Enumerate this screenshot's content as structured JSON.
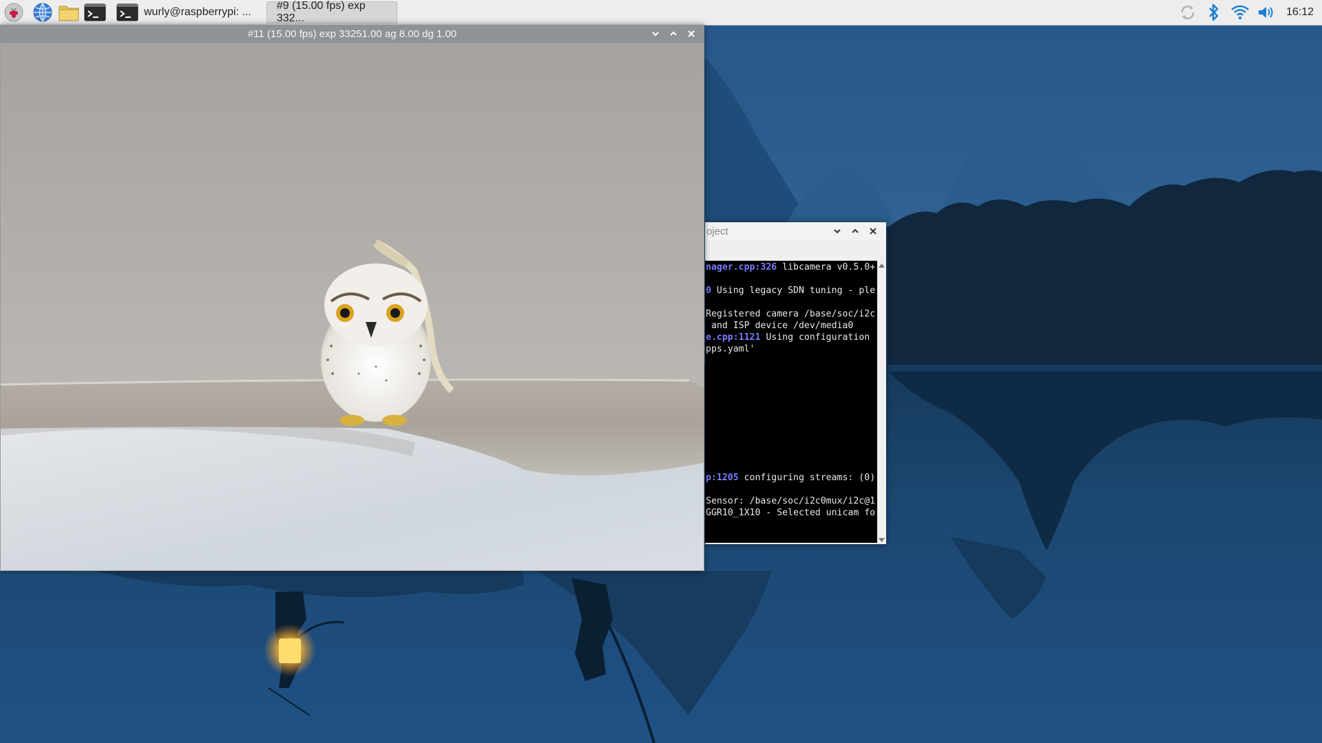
{
  "taskbar": {
    "launchers": [
      "raspberry-menu",
      "web-browser",
      "file-manager",
      "terminal"
    ],
    "tasks": [
      {
        "label": "wurly@raspberrypi: ...",
        "active": false
      },
      {
        "label": "#9 (15.00 fps) exp 332...",
        "active": true
      }
    ],
    "tray": [
      "sync-icon",
      "bluetooth-icon",
      "wifi-icon",
      "volume-icon"
    ],
    "clock": "16:12"
  },
  "camera_window": {
    "title": "#11 (15.00 fps) exp 33251.00 ag 8.00 dg 1.00"
  },
  "terminal_window": {
    "title": "oject",
    "lines": [
      {
        "hl": "nager.cpp:326",
        "text": " libcamera v0.5.0+"
      },
      {
        "hl": "0",
        "text": " Using legacy SDN tuning - ple"
      },
      {
        "hl": "",
        "text": "Registered camera /base/soc/i2c"
      },
      {
        "hl": "",
        "text": " and ISP device /dev/media0"
      },
      {
        "hl": "e.cpp:1121",
        "text": " Using configuration"
      },
      {
        "hl": "",
        "text": "pps.yaml'"
      },
      {
        "hl": "p:1205",
        "text": " configuring streams: (0)"
      },
      {
        "hl": "",
        "text": "Sensor: /base/soc/i2c0mux/i2c@1"
      },
      {
        "hl": "",
        "text": "GGR10_1X10 - Selected unicam fo"
      }
    ]
  },
  "colors": {
    "taskbar_bg": "#ededed",
    "camera_titlebar": "#8f9296",
    "terminal_bg": "#000000",
    "terminal_highlight": "#7b7bff",
    "tray_icon": "#1a7fd0"
  }
}
